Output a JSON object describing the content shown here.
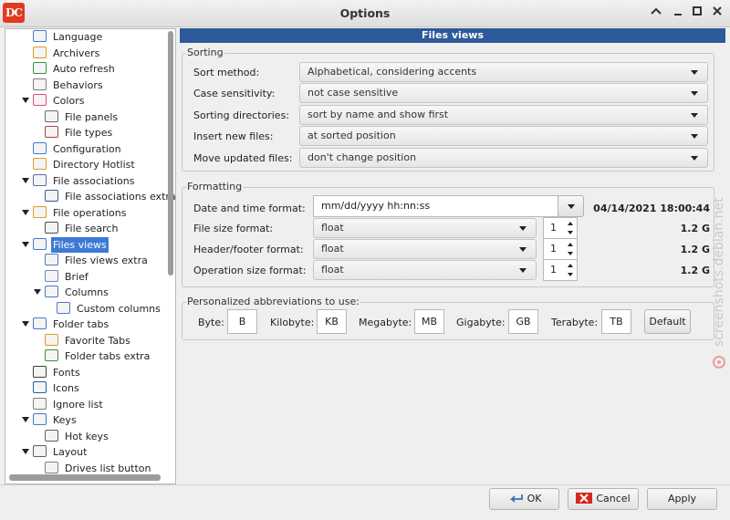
{
  "window": {
    "title": "Options"
  },
  "tree": {
    "items": [
      {
        "label": "Language",
        "icon": "language-icon",
        "level": 0
      },
      {
        "label": "Archivers",
        "icon": "archive-icon",
        "level": 0
      },
      {
        "label": "Auto refresh",
        "icon": "refresh-icon",
        "level": 0
      },
      {
        "label": "Behaviors",
        "icon": "behaviors-icon",
        "level": 0
      },
      {
        "label": "Colors",
        "icon": "color-wheel-icon",
        "level": 0,
        "expanded": true
      },
      {
        "label": "File panels",
        "icon": "file-panels-icon",
        "level": 1
      },
      {
        "label": "File types",
        "icon": "file-types-icon",
        "level": 1
      },
      {
        "label": "Configuration",
        "icon": "configuration-icon",
        "level": 0
      },
      {
        "label": "Directory Hotlist",
        "icon": "folder-star-icon",
        "level": 0
      },
      {
        "label": "File associations",
        "icon": "file-associations-icon",
        "level": 0,
        "expanded": true
      },
      {
        "label": "File associations extra",
        "icon": "file-associations-extra-icon",
        "level": 1
      },
      {
        "label": "File operations",
        "icon": "file-operations-icon",
        "level": 0,
        "expanded": true
      },
      {
        "label": "File search",
        "icon": "binoculars-icon",
        "level": 1
      },
      {
        "label": "Files views",
        "icon": "files-views-icon",
        "level": 0,
        "expanded": true,
        "selected": true
      },
      {
        "label": "Files views extra",
        "icon": "files-views-extra-icon",
        "level": 1
      },
      {
        "label": "Brief",
        "icon": "brief-view-icon",
        "level": 1
      },
      {
        "label": "Columns",
        "icon": "columns-view-icon",
        "level": 1,
        "expanded": true
      },
      {
        "label": "Custom columns",
        "icon": "custom-columns-icon",
        "level": 2
      },
      {
        "label": "Folder tabs",
        "icon": "folder-tabs-icon",
        "level": 0,
        "expanded": true
      },
      {
        "label": "Favorite Tabs",
        "icon": "favorite-tabs-icon",
        "level": 1
      },
      {
        "label": "Folder tabs extra",
        "icon": "folder-tabs-extra-icon",
        "level": 1
      },
      {
        "label": "Fonts",
        "icon": "fonts-icon",
        "level": 0
      },
      {
        "label": "Icons",
        "icon": "icons-icon",
        "level": 0
      },
      {
        "label": "Ignore list",
        "icon": "ignore-list-icon",
        "level": 0
      },
      {
        "label": "Keys",
        "icon": "keys-icon",
        "level": 0,
        "expanded": true
      },
      {
        "label": "Hot keys",
        "icon": "hot-keys-icon",
        "level": 1
      },
      {
        "label": "Layout",
        "icon": "layout-icon",
        "level": 0,
        "expanded": true
      },
      {
        "label": "Drives list button",
        "icon": "drives-list-icon",
        "level": 1
      }
    ]
  },
  "panel": {
    "header": "Files views",
    "sorting": {
      "title": "Sorting",
      "rows": [
        {
          "label": "Sort method:",
          "value": "Alphabetical, considering accents"
        },
        {
          "label": "Case sensitivity:",
          "value": "not case sensitive"
        },
        {
          "label": "Sorting directories:",
          "value": "sort by name and show first"
        },
        {
          "label": "Insert new files:",
          "value": "at sorted position"
        },
        {
          "label": "Move updated files:",
          "value": "don't change position"
        }
      ]
    },
    "formatting": {
      "title": "Formatting",
      "datetime": {
        "label": "Date and time format:",
        "value": "mm/dd/yyyy hh:nn:ss",
        "sample": "04/14/2021 18:00:44"
      },
      "rows": [
        {
          "label": "File size format:",
          "value": "float",
          "spin": "1",
          "sample": "1.2 G"
        },
        {
          "label": "Header/footer format:",
          "value": "float",
          "spin": "1",
          "sample": "1.2 G"
        },
        {
          "label": "Operation size format:",
          "value": "float",
          "spin": "1",
          "sample": "1.2 G"
        }
      ]
    },
    "abbreviations": {
      "title": "Personalized abbreviations to use:",
      "fields": [
        {
          "label": "Byte:",
          "value": "B"
        },
        {
          "label": "Kilobyte:",
          "value": "KB"
        },
        {
          "label": "Megabyte:",
          "value": "MB"
        },
        {
          "label": "Gigabyte:",
          "value": "GB"
        },
        {
          "label": "Terabyte:",
          "value": "TB"
        }
      ],
      "default_label": "Default"
    }
  },
  "buttons": {
    "ok": "OK",
    "cancel": "Cancel",
    "apply": "Apply"
  },
  "watermark": "screenshots.debian.net"
}
